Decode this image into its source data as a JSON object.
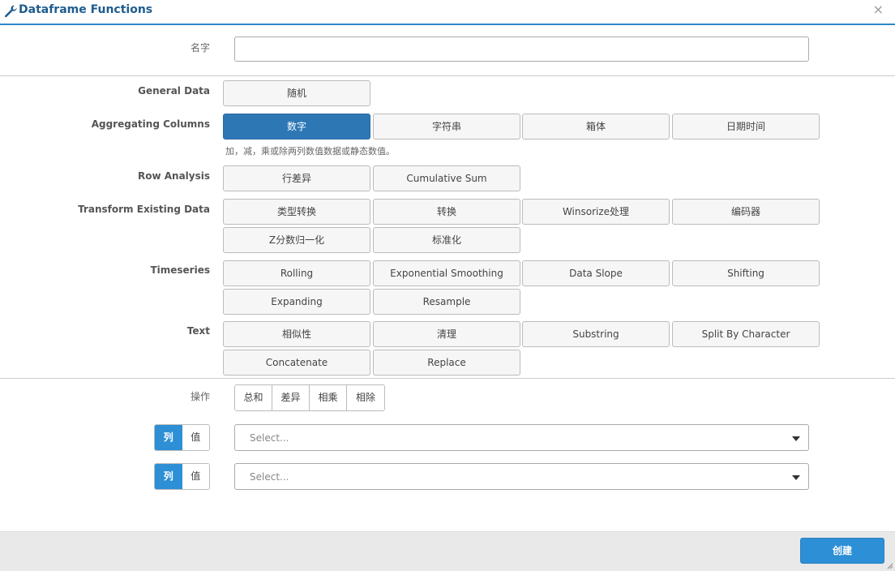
{
  "dialog": {
    "title": "Dataframe Functions",
    "title_icon": "wrench-icon",
    "close_label": "×"
  },
  "name_field": {
    "label": "名字",
    "value": "",
    "placeholder": ""
  },
  "sections": {
    "general": {
      "label": "General Data",
      "buttons": [
        "随机"
      ]
    },
    "aggregating": {
      "label": "Aggregating Columns",
      "buttons": [
        "数字",
        "字符串",
        "箱体",
        "日期时间"
      ],
      "active": "数字",
      "description": "加，减，乘或除两列数值数据或静态数值。"
    },
    "row": {
      "label": "Row Analysis",
      "buttons": [
        "行差异",
        "Cumulative Sum"
      ]
    },
    "transform": {
      "label": "Transform Existing Data",
      "buttons": [
        "类型转换",
        "转换",
        "Winsorize处理",
        "编码器",
        "Z分数归一化",
        "标准化"
      ]
    },
    "timeseries": {
      "label": "Timeseries",
      "buttons": [
        "Rolling",
        "Exponential Smoothing",
        "Data Slope",
        "Shifting",
        "Expanding",
        "Resample"
      ]
    },
    "text": {
      "label": "Text",
      "buttons": [
        "相似性",
        "清理",
        "Substring",
        "Split By Character",
        "Concatenate",
        "Replace"
      ]
    }
  },
  "operation": {
    "label": "操作",
    "options": [
      "总和",
      "差异",
      "相乘",
      "相除"
    ]
  },
  "operands": [
    {
      "toggle": [
        "列",
        "值"
      ],
      "selected": "列",
      "placeholder": "Select..."
    },
    {
      "toggle": [
        "列",
        "值"
      ],
      "selected": "列",
      "placeholder": "Select..."
    }
  ],
  "footer": {
    "create_label": "创建"
  },
  "colors": {
    "accent": "#2d8fd5",
    "active_button": "#2e77b5",
    "title": "#1f5c8f"
  }
}
